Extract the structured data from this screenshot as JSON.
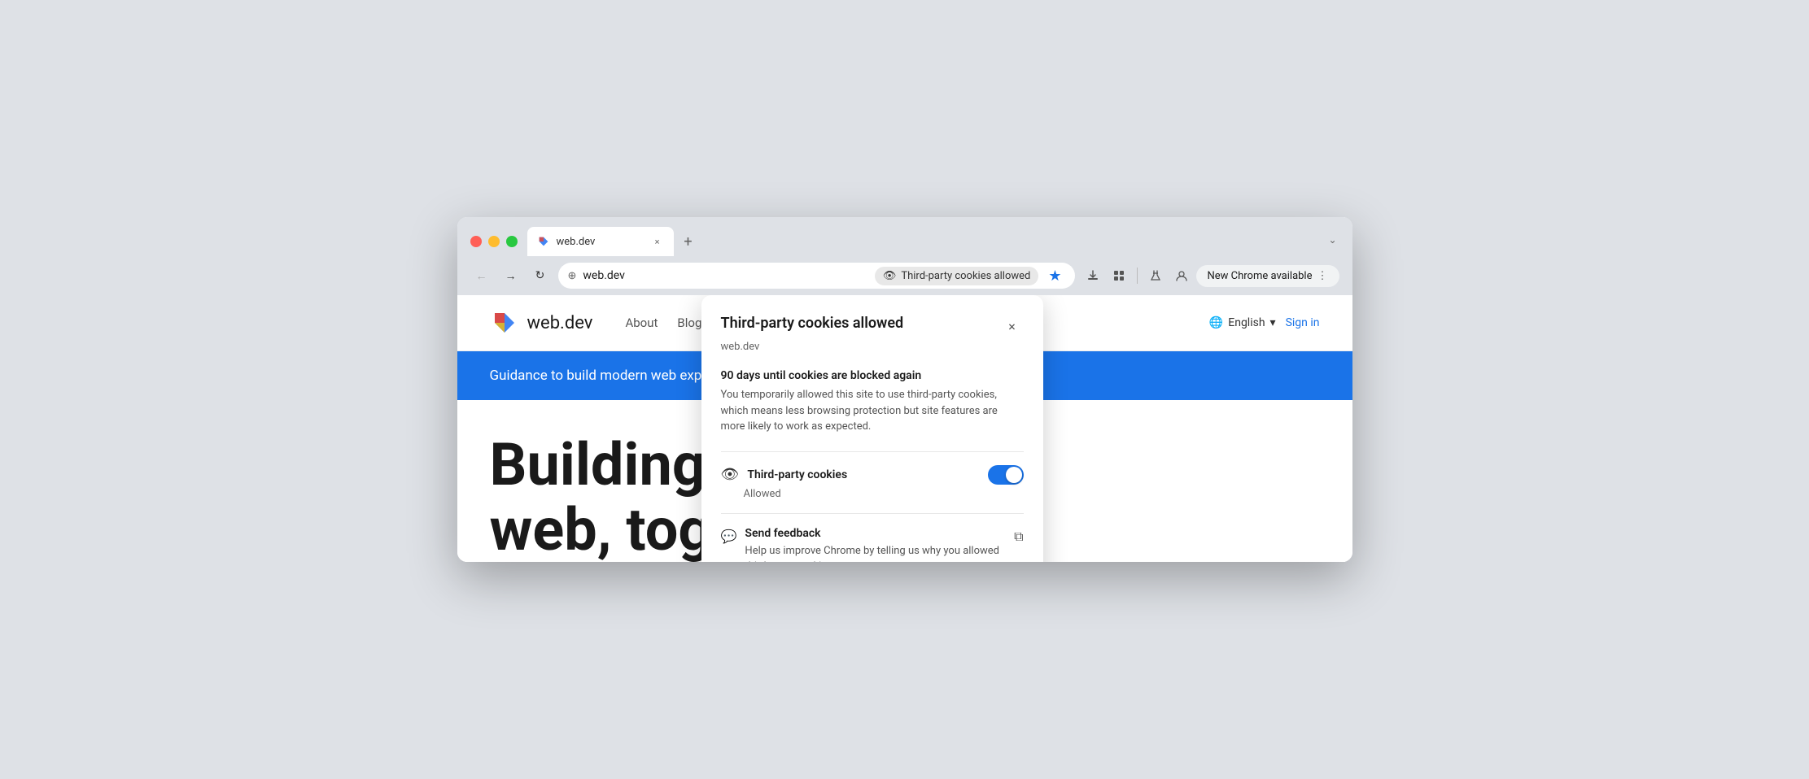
{
  "browser": {
    "tab": {
      "favicon_label": "web.dev favicon",
      "title": "web.dev",
      "close_label": "×",
      "new_tab_label": "+"
    },
    "nav": {
      "back_label": "←",
      "forward_label": "→",
      "refresh_label": "↻",
      "address": "web.dev",
      "address_icon": "⊕",
      "cookies_badge": "Third-party cookies allowed",
      "star_label": "★",
      "new_chrome_label": "New Chrome available",
      "more_label": "⋮",
      "extensions_label": "🧩",
      "labs_label": "🧪",
      "profile_label": "👤",
      "chevron_label": "⌄"
    }
  },
  "website": {
    "logo_text": "web.dev",
    "nav_items": [
      "About",
      "Blog"
    ],
    "lang_label": "English",
    "sign_in_label": "Sign in",
    "banner_text": "Guidance to build modern web experiences that work",
    "headline_line1": "Building a bet",
    "headline_line2": "web, togethe"
  },
  "popup": {
    "title": "Third-party cookies allowed",
    "domain": "web.dev",
    "close_label": "×",
    "warning_title": "90 days until cookies are blocked again",
    "warning_text": "You temporarily allowed this site to use third-party cookies, which means less browsing protection but site features are more likely to work as expected.",
    "toggle_label": "Third-party cookies",
    "toggle_sublabel": "Allowed",
    "toggle_icon": "👁",
    "feedback_title": "Send feedback",
    "feedback_text": "Help us improve Chrome by telling us why you allowed third-party cookies",
    "feedback_icon": "💬",
    "feedback_external_icon": "⧉"
  }
}
